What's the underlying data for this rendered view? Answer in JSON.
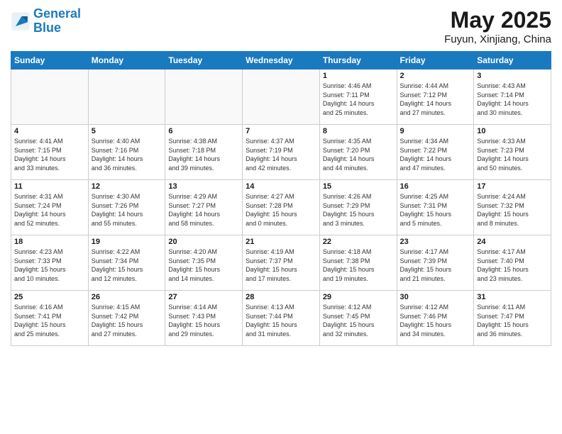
{
  "logo": {
    "line1": "General",
    "line2": "Blue"
  },
  "title": "May 2025",
  "subtitle": "Fuyun, Xinjiang, China",
  "weekdays": [
    "Sunday",
    "Monday",
    "Tuesday",
    "Wednesday",
    "Thursday",
    "Friday",
    "Saturday"
  ],
  "weeks": [
    [
      {
        "day": "",
        "info": ""
      },
      {
        "day": "",
        "info": ""
      },
      {
        "day": "",
        "info": ""
      },
      {
        "day": "",
        "info": ""
      },
      {
        "day": "1",
        "info": "Sunrise: 4:46 AM\nSunset: 7:11 PM\nDaylight: 14 hours\nand 25 minutes."
      },
      {
        "day": "2",
        "info": "Sunrise: 4:44 AM\nSunset: 7:12 PM\nDaylight: 14 hours\nand 27 minutes."
      },
      {
        "day": "3",
        "info": "Sunrise: 4:43 AM\nSunset: 7:14 PM\nDaylight: 14 hours\nand 30 minutes."
      }
    ],
    [
      {
        "day": "4",
        "info": "Sunrise: 4:41 AM\nSunset: 7:15 PM\nDaylight: 14 hours\nand 33 minutes."
      },
      {
        "day": "5",
        "info": "Sunrise: 4:40 AM\nSunset: 7:16 PM\nDaylight: 14 hours\nand 36 minutes."
      },
      {
        "day": "6",
        "info": "Sunrise: 4:38 AM\nSunset: 7:18 PM\nDaylight: 14 hours\nand 39 minutes."
      },
      {
        "day": "7",
        "info": "Sunrise: 4:37 AM\nSunset: 7:19 PM\nDaylight: 14 hours\nand 42 minutes."
      },
      {
        "day": "8",
        "info": "Sunrise: 4:35 AM\nSunset: 7:20 PM\nDaylight: 14 hours\nand 44 minutes."
      },
      {
        "day": "9",
        "info": "Sunrise: 4:34 AM\nSunset: 7:22 PM\nDaylight: 14 hours\nand 47 minutes."
      },
      {
        "day": "10",
        "info": "Sunrise: 4:33 AM\nSunset: 7:23 PM\nDaylight: 14 hours\nand 50 minutes."
      }
    ],
    [
      {
        "day": "11",
        "info": "Sunrise: 4:31 AM\nSunset: 7:24 PM\nDaylight: 14 hours\nand 52 minutes."
      },
      {
        "day": "12",
        "info": "Sunrise: 4:30 AM\nSunset: 7:26 PM\nDaylight: 14 hours\nand 55 minutes."
      },
      {
        "day": "13",
        "info": "Sunrise: 4:29 AM\nSunset: 7:27 PM\nDaylight: 14 hours\nand 58 minutes."
      },
      {
        "day": "14",
        "info": "Sunrise: 4:27 AM\nSunset: 7:28 PM\nDaylight: 15 hours\nand 0 minutes."
      },
      {
        "day": "15",
        "info": "Sunrise: 4:26 AM\nSunset: 7:29 PM\nDaylight: 15 hours\nand 3 minutes."
      },
      {
        "day": "16",
        "info": "Sunrise: 4:25 AM\nSunset: 7:31 PM\nDaylight: 15 hours\nand 5 minutes."
      },
      {
        "day": "17",
        "info": "Sunrise: 4:24 AM\nSunset: 7:32 PM\nDaylight: 15 hours\nand 8 minutes."
      }
    ],
    [
      {
        "day": "18",
        "info": "Sunrise: 4:23 AM\nSunset: 7:33 PM\nDaylight: 15 hours\nand 10 minutes."
      },
      {
        "day": "19",
        "info": "Sunrise: 4:22 AM\nSunset: 7:34 PM\nDaylight: 15 hours\nand 12 minutes."
      },
      {
        "day": "20",
        "info": "Sunrise: 4:20 AM\nSunset: 7:35 PM\nDaylight: 15 hours\nand 14 minutes."
      },
      {
        "day": "21",
        "info": "Sunrise: 4:19 AM\nSunset: 7:37 PM\nDaylight: 15 hours\nand 17 minutes."
      },
      {
        "day": "22",
        "info": "Sunrise: 4:18 AM\nSunset: 7:38 PM\nDaylight: 15 hours\nand 19 minutes."
      },
      {
        "day": "23",
        "info": "Sunrise: 4:17 AM\nSunset: 7:39 PM\nDaylight: 15 hours\nand 21 minutes."
      },
      {
        "day": "24",
        "info": "Sunrise: 4:17 AM\nSunset: 7:40 PM\nDaylight: 15 hours\nand 23 minutes."
      }
    ],
    [
      {
        "day": "25",
        "info": "Sunrise: 4:16 AM\nSunset: 7:41 PM\nDaylight: 15 hours\nand 25 minutes."
      },
      {
        "day": "26",
        "info": "Sunrise: 4:15 AM\nSunset: 7:42 PM\nDaylight: 15 hours\nand 27 minutes."
      },
      {
        "day": "27",
        "info": "Sunrise: 4:14 AM\nSunset: 7:43 PM\nDaylight: 15 hours\nand 29 minutes."
      },
      {
        "day": "28",
        "info": "Sunrise: 4:13 AM\nSunset: 7:44 PM\nDaylight: 15 hours\nand 31 minutes."
      },
      {
        "day": "29",
        "info": "Sunrise: 4:12 AM\nSunset: 7:45 PM\nDaylight: 15 hours\nand 32 minutes."
      },
      {
        "day": "30",
        "info": "Sunrise: 4:12 AM\nSunset: 7:46 PM\nDaylight: 15 hours\nand 34 minutes."
      },
      {
        "day": "31",
        "info": "Sunrise: 4:11 AM\nSunset: 7:47 PM\nDaylight: 15 hours\nand 36 minutes."
      }
    ]
  ]
}
